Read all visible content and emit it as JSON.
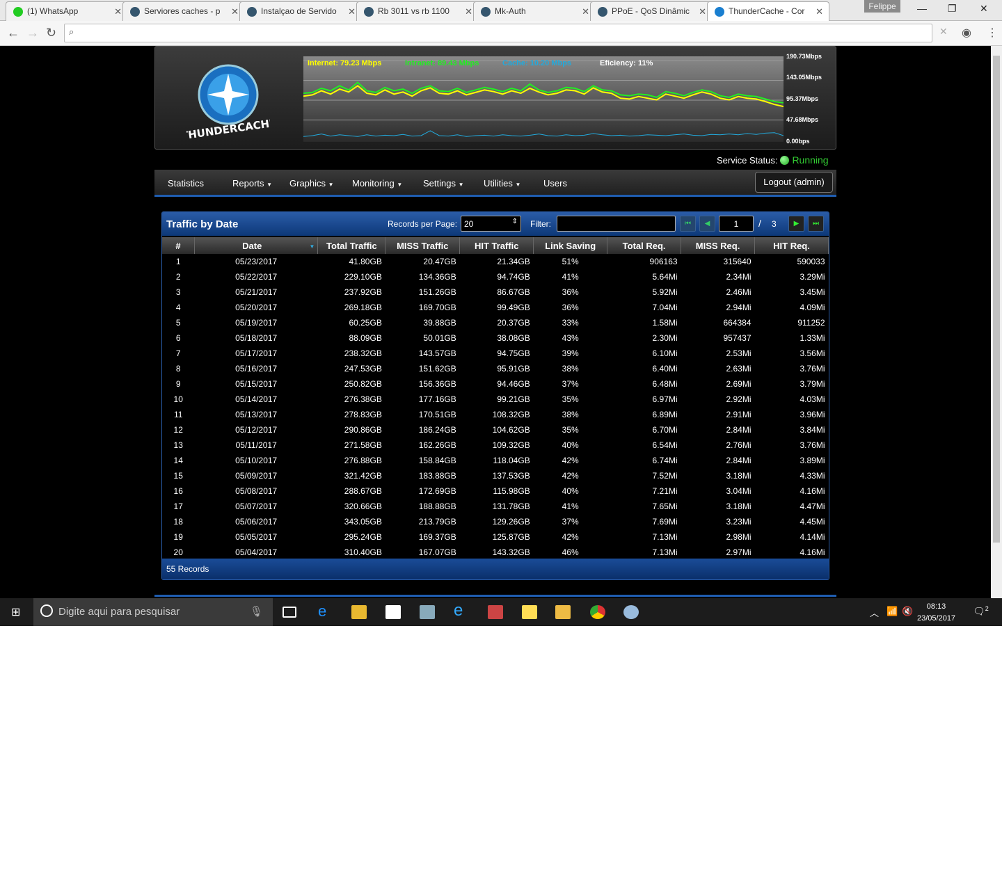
{
  "browser": {
    "tabs": [
      {
        "label": "(1) WhatsApp",
        "icon": "whatsapp-icon"
      },
      {
        "label": "Serviores caches - p",
        "icon": "mikrotik-icon"
      },
      {
        "label": "Instalçao de Servido",
        "icon": "mikrotik-icon"
      },
      {
        "label": "Rb 3011 vs rb 1100",
        "icon": "mikrotik-icon"
      },
      {
        "label": "Mk-Auth",
        "icon": "mikrotik-icon"
      },
      {
        "label": "PPoE - QoS Dinâmic",
        "icon": "mikrotik-icon"
      },
      {
        "label": "ThunderCache - Cor",
        "icon": "thundercache-icon"
      }
    ],
    "user": "Felippe",
    "address": ""
  },
  "header": {
    "logo_text": "THUNDERCACHE",
    "legend": {
      "internet": "Internet: 79.23 Mbps",
      "intranet": "Intranet: 89.43 Mbps",
      "cache": "Cache: 10.20 Mbps",
      "efficiency": "Eficiency: 11%"
    },
    "y_ticks": [
      "190.73Mbps",
      "143.05Mbps",
      "95.37Mbps",
      "47.68Mbps",
      "0.00bps"
    ],
    "colors": {
      "internet": "#ffff00",
      "intranet": "#22ee22",
      "cache": "#22aadd"
    },
    "series": {
      "internet": [
        105,
        108,
        118,
        110,
        122,
        115,
        130,
        112,
        108,
        120,
        110,
        115,
        105,
        118,
        125,
        112,
        110,
        118,
        108,
        114,
        120,
        116,
        110,
        118,
        112,
        124,
        115,
        108,
        112,
        120,
        118,
        110,
        125,
        115,
        112,
        100,
        98,
        104,
        100,
        96,
        110,
        105,
        100,
        108,
        115,
        110,
        100,
        96,
        104,
        100,
        98,
        92,
        85,
        80
      ],
      "intranet": [
        112,
        114,
        124,
        118,
        130,
        120,
        138,
        118,
        114,
        126,
        118,
        122,
        112,
        124,
        130,
        118,
        116,
        124,
        114,
        120,
        126,
        122,
        116,
        124,
        118,
        134,
        120,
        114,
        118,
        126,
        124,
        116,
        130,
        120,
        118,
        108,
        106,
        110,
        108,
        102,
        116,
        112,
        106,
        114,
        120,
        116,
        106,
        102,
        110,
        106,
        104,
        98,
        92,
        89
      ],
      "cache": [
        8,
        10,
        14,
        9,
        12,
        10,
        8,
        12,
        9,
        11,
        10,
        13,
        9,
        10,
        22,
        10,
        9,
        12,
        8,
        10,
        11,
        9,
        12,
        10,
        9,
        11,
        14,
        10,
        9,
        12,
        10,
        11,
        15,
        12,
        10,
        11,
        9,
        10,
        12,
        11,
        10,
        12,
        14,
        11,
        10,
        13,
        12,
        14,
        12,
        15,
        13,
        16,
        17,
        10
      ]
    },
    "y_max": 190.73
  },
  "service": {
    "label": "Service Status:",
    "value": "Running"
  },
  "menu": {
    "items": [
      "Statistics",
      "Reports",
      "Graphics",
      "Monitoring",
      "Settings",
      "Utilities",
      "Users"
    ],
    "logout": "Logout (admin)"
  },
  "panel": {
    "title": "Traffic by Date",
    "records_label": "Records per Page:",
    "records_value": "20",
    "filter_label": "Filter:",
    "filter_value": "",
    "page": "1",
    "page_sep": "/",
    "pages": "3",
    "columns": [
      "#",
      "Date",
      "Total Traffic",
      "MISS Traffic",
      "HIT Traffic",
      "Link Saving",
      "Total Req.",
      "MISS Req.",
      "HIT Req."
    ],
    "rows": [
      [
        "1",
        "05/23/2017",
        "41.80GB",
        "20.47GB",
        "21.34GB",
        "51%",
        "906163",
        "315640",
        "590033"
      ],
      [
        "2",
        "05/22/2017",
        "229.10GB",
        "134.36GB",
        "94.74GB",
        "41%",
        "5.64Mi",
        "2.34Mi",
        "3.29Mi"
      ],
      [
        "3",
        "05/21/2017",
        "237.92GB",
        "151.26GB",
        "86.67GB",
        "36%",
        "5.92Mi",
        "2.46Mi",
        "3.45Mi"
      ],
      [
        "4",
        "05/20/2017",
        "269.18GB",
        "169.70GB",
        "99.49GB",
        "36%",
        "7.04Mi",
        "2.94Mi",
        "4.09Mi"
      ],
      [
        "5",
        "05/19/2017",
        "60.25GB",
        "39.88GB",
        "20.37GB",
        "33%",
        "1.58Mi",
        "664384",
        "911252"
      ],
      [
        "6",
        "05/18/2017",
        "88.09GB",
        "50.01GB",
        "38.08GB",
        "43%",
        "2.30Mi",
        "957437",
        "1.33Mi"
      ],
      [
        "7",
        "05/17/2017",
        "238.32GB",
        "143.57GB",
        "94.75GB",
        "39%",
        "6.10Mi",
        "2.53Mi",
        "3.56Mi"
      ],
      [
        "8",
        "05/16/2017",
        "247.53GB",
        "151.62GB",
        "95.91GB",
        "38%",
        "6.40Mi",
        "2.63Mi",
        "3.76Mi"
      ],
      [
        "9",
        "05/15/2017",
        "250.82GB",
        "156.36GB",
        "94.46GB",
        "37%",
        "6.48Mi",
        "2.69Mi",
        "3.79Mi"
      ],
      [
        "10",
        "05/14/2017",
        "276.38GB",
        "177.16GB",
        "99.21GB",
        "35%",
        "6.97Mi",
        "2.92Mi",
        "4.03Mi"
      ],
      [
        "11",
        "05/13/2017",
        "278.83GB",
        "170.51GB",
        "108.32GB",
        "38%",
        "6.89Mi",
        "2.91Mi",
        "3.96Mi"
      ],
      [
        "12",
        "05/12/2017",
        "290.86GB",
        "186.24GB",
        "104.62GB",
        "35%",
        "6.70Mi",
        "2.84Mi",
        "3.84Mi"
      ],
      [
        "13",
        "05/11/2017",
        "271.58GB",
        "162.26GB",
        "109.32GB",
        "40%",
        "6.54Mi",
        "2.76Mi",
        "3.76Mi"
      ],
      [
        "14",
        "05/10/2017",
        "276.88GB",
        "158.84GB",
        "118.04GB",
        "42%",
        "6.74Mi",
        "2.84Mi",
        "3.89Mi"
      ],
      [
        "15",
        "05/09/2017",
        "321.42GB",
        "183.88GB",
        "137.53GB",
        "42%",
        "7.52Mi",
        "3.18Mi",
        "4.33Mi"
      ],
      [
        "16",
        "05/08/2017",
        "288.67GB",
        "172.69GB",
        "115.98GB",
        "40%",
        "7.21Mi",
        "3.04Mi",
        "4.16Mi"
      ],
      [
        "17",
        "05/07/2017",
        "320.66GB",
        "188.88GB",
        "131.78GB",
        "41%",
        "7.65Mi",
        "3.18Mi",
        "4.47Mi"
      ],
      [
        "18",
        "05/06/2017",
        "343.05GB",
        "213.79GB",
        "129.26GB",
        "37%",
        "7.69Mi",
        "3.23Mi",
        "4.45Mi"
      ],
      [
        "19",
        "05/05/2017",
        "295.24GB",
        "169.37GB",
        "125.87GB",
        "42%",
        "7.13Mi",
        "2.98Mi",
        "4.14Mi"
      ],
      [
        "20",
        "05/04/2017",
        "310.40GB",
        "167.07GB",
        "143.32GB",
        "46%",
        "7.13Mi",
        "2.97Mi",
        "4.16Mi"
      ]
    ],
    "footer": "55 Records"
  },
  "taskbar": {
    "search_placeholder": "Digite aqui para pesquisar",
    "time": "08:13",
    "date": "23/05/2017",
    "notifications": "2"
  }
}
